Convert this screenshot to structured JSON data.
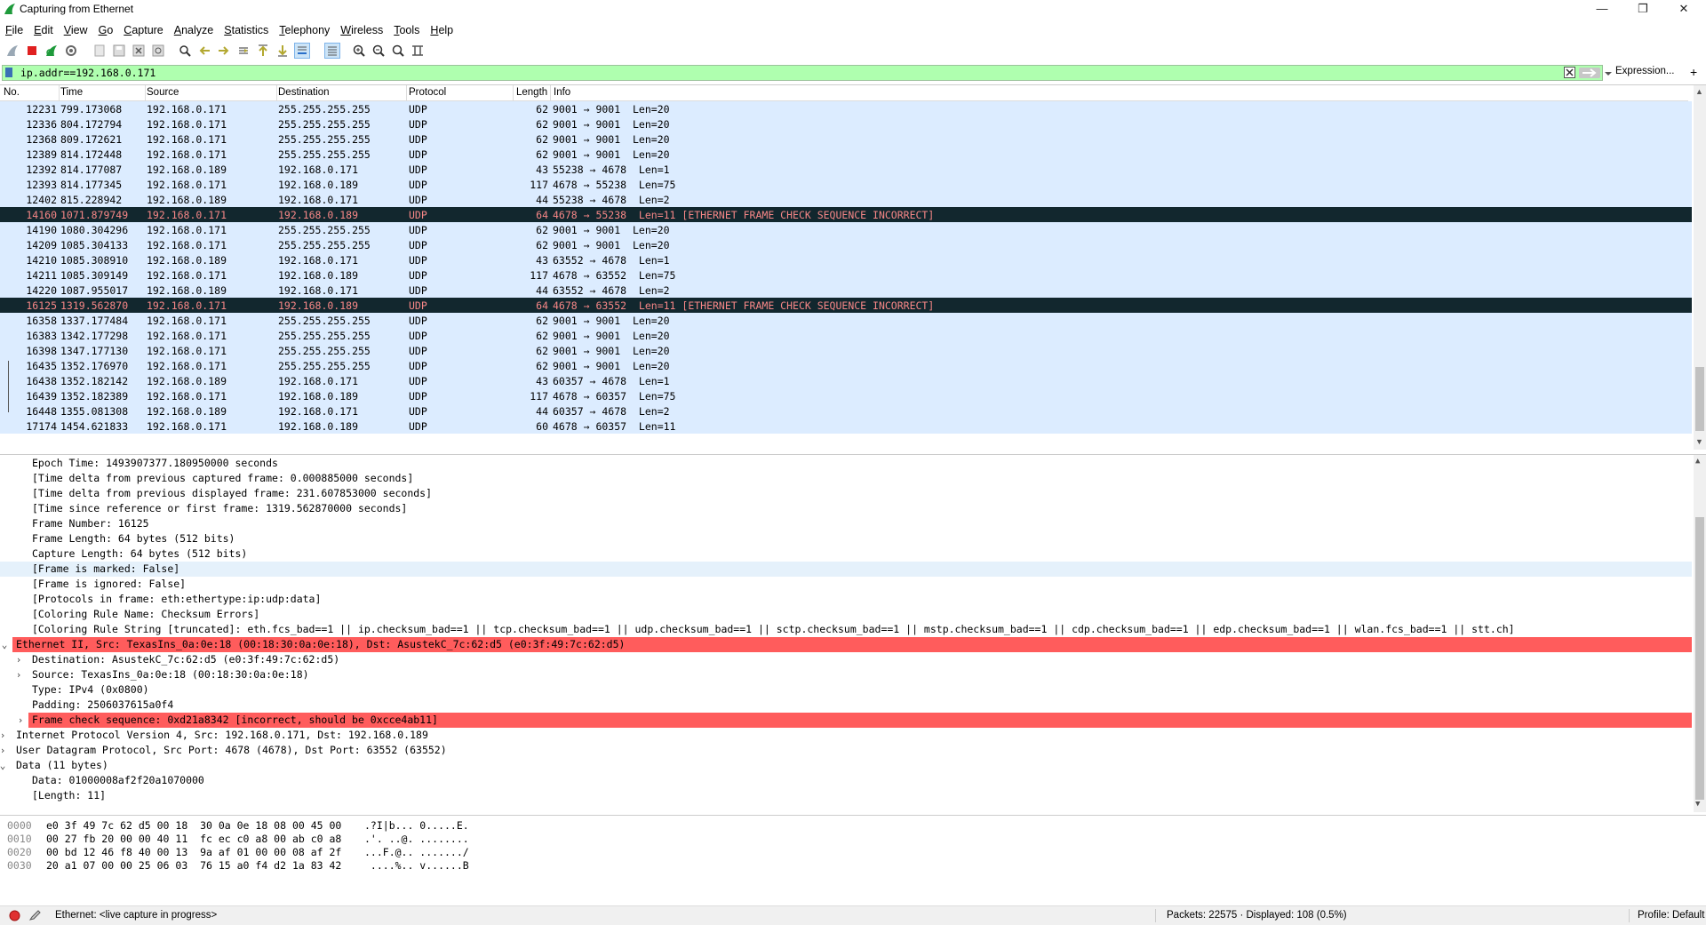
{
  "window": {
    "title": "Capturing from Ethernet"
  },
  "menu": [
    "File",
    "Edit",
    "View",
    "Go",
    "Capture",
    "Analyze",
    "Statistics",
    "Telephony",
    "Wireless",
    "Tools",
    "Help"
  ],
  "toolbar_icons": [
    "shark-fin-start-icon",
    "stop-capture-icon",
    "restart-capture-icon",
    "capture-options-icon",
    "open-file-icon",
    "save-file-icon",
    "close-file-icon",
    "reload-file-icon",
    "find-packet-icon",
    "go-back-icon",
    "go-forward-icon",
    "go-to-packet-icon",
    "go-first-icon",
    "go-last-icon",
    "autoscroll-icon",
    "colorize-icon",
    "zoom-in-icon",
    "zoom-out-icon",
    "zoom-normal-icon",
    "resize-columns-icon"
  ],
  "filter": {
    "value": "ip.addr==192.168.0.171",
    "expression_label": "Expression...",
    "add_label": "+"
  },
  "packet_columns": [
    "No.",
    "Time",
    "Source",
    "Destination",
    "Protocol",
    "Length",
    "Info"
  ],
  "packets": [
    {
      "no": "12231",
      "time": "799.173068",
      "src": "192.168.0.171",
      "dst": "255.255.255.255",
      "proto": "UDP",
      "len": "62",
      "info": "9001 → 9001  Len=20",
      "bad": false
    },
    {
      "no": "12336",
      "time": "804.172794",
      "src": "192.168.0.171",
      "dst": "255.255.255.255",
      "proto": "UDP",
      "len": "62",
      "info": "9001 → 9001  Len=20",
      "bad": false
    },
    {
      "no": "12368",
      "time": "809.172621",
      "src": "192.168.0.171",
      "dst": "255.255.255.255",
      "proto": "UDP",
      "len": "62",
      "info": "9001 → 9001  Len=20",
      "bad": false
    },
    {
      "no": "12389",
      "time": "814.172448",
      "src": "192.168.0.171",
      "dst": "255.255.255.255",
      "proto": "UDP",
      "len": "62",
      "info": "9001 → 9001  Len=20",
      "bad": false
    },
    {
      "no": "12392",
      "time": "814.177087",
      "src": "192.168.0.189",
      "dst": "192.168.0.171",
      "proto": "UDP",
      "len": "43",
      "info": "55238 → 4678  Len=1",
      "bad": false
    },
    {
      "no": "12393",
      "time": "814.177345",
      "src": "192.168.0.171",
      "dst": "192.168.0.189",
      "proto": "UDP",
      "len": "117",
      "info": "4678 → 55238  Len=75",
      "bad": false
    },
    {
      "no": "12402",
      "time": "815.228942",
      "src": "192.168.0.189",
      "dst": "192.168.0.171",
      "proto": "UDP",
      "len": "44",
      "info": "55238 → 4678  Len=2",
      "bad": false
    },
    {
      "no": "14160",
      "time": "1071.879749",
      "src": "192.168.0.171",
      "dst": "192.168.0.189",
      "proto": "UDP",
      "len": "64",
      "info": "4678 → 55238  Len=11 [ETHERNET FRAME CHECK SEQUENCE INCORRECT]",
      "bad": true
    },
    {
      "no": "14190",
      "time": "1080.304296",
      "src": "192.168.0.171",
      "dst": "255.255.255.255",
      "proto": "UDP",
      "len": "62",
      "info": "9001 → 9001  Len=20",
      "bad": false
    },
    {
      "no": "14209",
      "time": "1085.304133",
      "src": "192.168.0.171",
      "dst": "255.255.255.255",
      "proto": "UDP",
      "len": "62",
      "info": "9001 → 9001  Len=20",
      "bad": false
    },
    {
      "no": "14210",
      "time": "1085.308910",
      "src": "192.168.0.189",
      "dst": "192.168.0.171",
      "proto": "UDP",
      "len": "43",
      "info": "63552 → 4678  Len=1",
      "bad": false
    },
    {
      "no": "14211",
      "time": "1085.309149",
      "src": "192.168.0.171",
      "dst": "192.168.0.189",
      "proto": "UDP",
      "len": "117",
      "info": "4678 → 63552  Len=75",
      "bad": false
    },
    {
      "no": "14220",
      "time": "1087.955017",
      "src": "192.168.0.189",
      "dst": "192.168.0.171",
      "proto": "UDP",
      "len": "44",
      "info": "63552 → 4678  Len=2",
      "bad": false
    },
    {
      "no": "16125",
      "time": "1319.562870",
      "src": "192.168.0.171",
      "dst": "192.168.0.189",
      "proto": "UDP",
      "len": "64",
      "info": "4678 → 63552  Len=11 [ETHERNET FRAME CHECK SEQUENCE INCORRECT]",
      "bad": true
    },
    {
      "no": "16358",
      "time": "1337.177484",
      "src": "192.168.0.171",
      "dst": "255.255.255.255",
      "proto": "UDP",
      "len": "62",
      "info": "9001 → 9001  Len=20",
      "bad": false
    },
    {
      "no": "16383",
      "time": "1342.177298",
      "src": "192.168.0.171",
      "dst": "255.255.255.255",
      "proto": "UDP",
      "len": "62",
      "info": "9001 → 9001  Len=20",
      "bad": false
    },
    {
      "no": "16398",
      "time": "1347.177130",
      "src": "192.168.0.171",
      "dst": "255.255.255.255",
      "proto": "UDP",
      "len": "62",
      "info": "9001 → 9001  Len=20",
      "bad": false
    },
    {
      "no": "16435",
      "time": "1352.176970",
      "src": "192.168.0.171",
      "dst": "255.255.255.255",
      "proto": "UDP",
      "len": "62",
      "info": "9001 → 9001  Len=20",
      "bad": false
    },
    {
      "no": "16438",
      "time": "1352.182142",
      "src": "192.168.0.189",
      "dst": "192.168.0.171",
      "proto": "UDP",
      "len": "43",
      "info": "60357 → 4678  Len=1",
      "bad": false
    },
    {
      "no": "16439",
      "time": "1352.182389",
      "src": "192.168.0.171",
      "dst": "192.168.0.189",
      "proto": "UDP",
      "len": "117",
      "info": "4678 → 60357  Len=75",
      "bad": false
    },
    {
      "no": "16448",
      "time": "1355.081308",
      "src": "192.168.0.189",
      "dst": "192.168.0.171",
      "proto": "UDP",
      "len": "44",
      "info": "60357 → 4678  Len=2",
      "bad": false
    },
    {
      "no": "17174",
      "time": "1454.621833",
      "src": "192.168.0.171",
      "dst": "192.168.0.189",
      "proto": "UDP",
      "len": "60",
      "info": "4678 → 60357  Len=11",
      "bad": false
    }
  ],
  "details": [
    {
      "indent": 2,
      "exp": "",
      "text": "Epoch Time: 1493907377.180950000 seconds",
      "style": ""
    },
    {
      "indent": 2,
      "exp": "",
      "text": "[Time delta from previous captured frame: 0.000885000 seconds]",
      "style": ""
    },
    {
      "indent": 2,
      "exp": "",
      "text": "[Time delta from previous displayed frame: 231.607853000 seconds]",
      "style": ""
    },
    {
      "indent": 2,
      "exp": "",
      "text": "[Time since reference or first frame: 1319.562870000 seconds]",
      "style": ""
    },
    {
      "indent": 2,
      "exp": "",
      "text": "Frame Number: 16125",
      "style": ""
    },
    {
      "indent": 2,
      "exp": "",
      "text": "Frame Length: 64 bytes (512 bits)",
      "style": ""
    },
    {
      "indent": 2,
      "exp": "",
      "text": "Capture Length: 64 bytes (512 bits)",
      "style": ""
    },
    {
      "indent": 2,
      "exp": "",
      "text": "[Frame is marked: False]",
      "style": "hl"
    },
    {
      "indent": 2,
      "exp": "",
      "text": "[Frame is ignored: False]",
      "style": ""
    },
    {
      "indent": 2,
      "exp": "",
      "text": "[Protocols in frame: eth:ethertype:ip:udp:data]",
      "style": ""
    },
    {
      "indent": 2,
      "exp": "",
      "text": "[Coloring Rule Name: Checksum Errors]",
      "style": ""
    },
    {
      "indent": 2,
      "exp": "",
      "text": "[Coloring Rule String [truncated]: eth.fcs_bad==1 || ip.checksum_bad==1 || tcp.checksum_bad==1 || udp.checksum_bad==1 || sctp.checksum_bad==1 || mstp.checksum_bad==1 || cdp.checksum_bad==1 || edp.checksum_bad==1 || wlan.fcs_bad==1 || stt.ch]",
      "style": ""
    },
    {
      "indent": 1,
      "exp": "⌄",
      "text": "Ethernet II, Src: TexasIns_0a:0e:18 (00:18:30:0a:0e:18), Dst: AsustekC_7c:62:d5 (e0:3f:49:7c:62:d5)",
      "style": "red"
    },
    {
      "indent": 2,
      "exp": "›",
      "text": "Destination: AsustekC_7c:62:d5 (e0:3f:49:7c:62:d5)",
      "style": ""
    },
    {
      "indent": 2,
      "exp": "›",
      "text": "Source: TexasIns_0a:0e:18 (00:18:30:0a:0e:18)",
      "style": ""
    },
    {
      "indent": 2,
      "exp": "",
      "text": "Type: IPv4 (0x0800)",
      "style": ""
    },
    {
      "indent": 2,
      "exp": "",
      "text": "Padding: 2506037615a0f4",
      "style": ""
    },
    {
      "indent": 2,
      "exp": "›",
      "text": "Frame check sequence: 0xd21a8342 [incorrect, should be 0xcce4ab11]",
      "style": "red"
    },
    {
      "indent": 1,
      "exp": "›",
      "text": "Internet Protocol Version 4, Src: 192.168.0.171, Dst: 192.168.0.189",
      "style": ""
    },
    {
      "indent": 1,
      "exp": "›",
      "text": "User Datagram Protocol, Src Port: 4678 (4678), Dst Port: 63552 (63552)",
      "style": ""
    },
    {
      "indent": 1,
      "exp": "⌄",
      "text": "Data (11 bytes)",
      "style": ""
    },
    {
      "indent": 2,
      "exp": "",
      "text": "Data: 01000008af2f20a1070000",
      "style": ""
    },
    {
      "indent": 2,
      "exp": "",
      "text": "[Length: 11]",
      "style": ""
    }
  ],
  "bytes": [
    {
      "off": "0000",
      "hex": "e0 3f 49 7c 62 d5 00 18  30 0a 0e 18 08 00 45 00",
      "ascii": ".?I|b... 0.....E."
    },
    {
      "off": "0010",
      "hex": "00 27 fb 20 00 00 40 11  fc ec c0 a8 00 ab c0 a8",
      "ascii": ".'. ..@. ........"
    },
    {
      "off": "0020",
      "hex": "00 bd 12 46 f8 40 00 13  9a af 01 00 00 08 af 2f",
      "ascii": "...F.@.. ......./"
    },
    {
      "off": "0030",
      "hex": "20 a1 07 00 00 25 06 03  76 15 a0 f4 d2 1a 83 42",
      "ascii": " ....%.. v......B"
    }
  ],
  "status": {
    "interface": "Ethernet: <live capture in progress>",
    "packets": "Packets: 22575 · Displayed: 108 (0.5%)",
    "profile": "Profile: Default"
  }
}
